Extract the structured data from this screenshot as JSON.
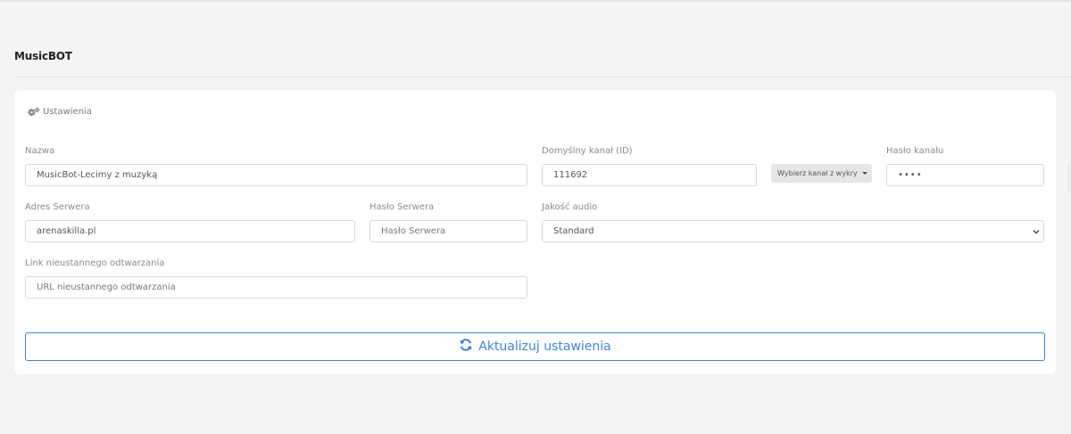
{
  "page": {
    "title": "MusicBOT"
  },
  "card": {
    "header_icon": "gears-icon",
    "header_label": "Ustawienia"
  },
  "form": {
    "name": {
      "label": "Nazwa",
      "value": "MusicBot-Lecimy z muzyką"
    },
    "default_channel": {
      "label": "Domyślny kanał (ID)",
      "value": "111692"
    },
    "channel_picker": {
      "label": "Wybierz kanał z wykrytych"
    },
    "channel_password": {
      "label": "Hasło kanału",
      "value": "••••"
    },
    "server_address": {
      "label": "Adres Serwera",
      "value": "arenaskilla.pl"
    },
    "server_password": {
      "label": "Hasło Serwera",
      "placeholder": "Hasło Serwera"
    },
    "audio_quality": {
      "label": "Jakość audio",
      "selected": "Standard"
    },
    "stream_link": {
      "label": "Link nieustannego odtwarzania",
      "placeholder": "URL nieustannego odtwarzania"
    }
  },
  "actions": {
    "update_label": "Aktualizuj ustawienia",
    "update_icon": "refresh-icon",
    "accent": "#3d85d8"
  }
}
